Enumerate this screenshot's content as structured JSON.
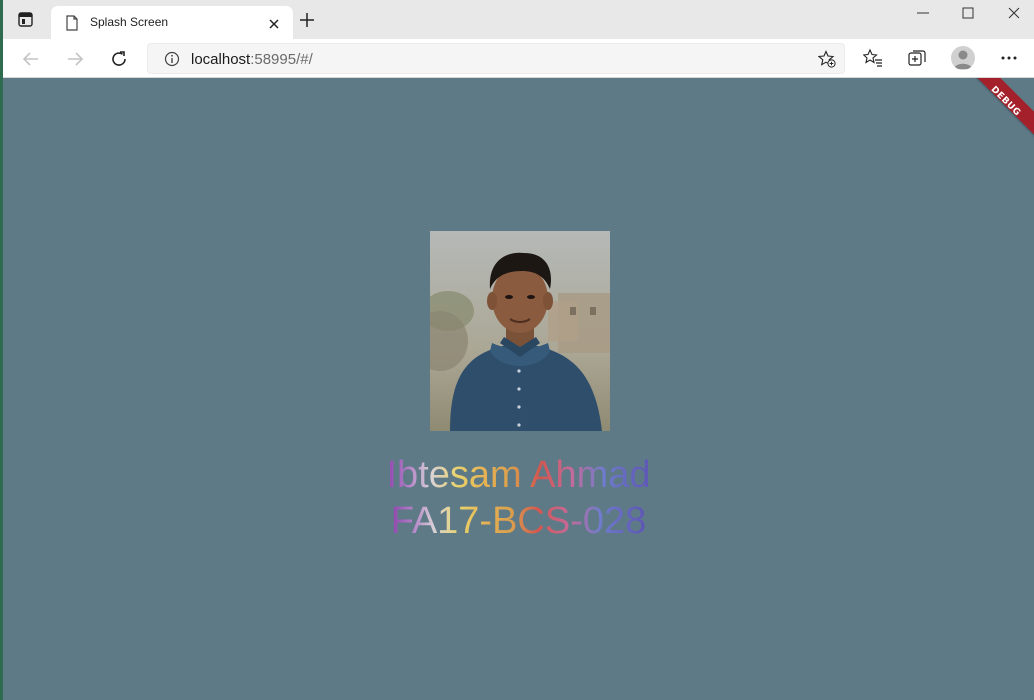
{
  "browser": {
    "tab_title": "Splash Screen",
    "url_host": "localhost",
    "url_rest": ":58995/#/"
  },
  "icons": {
    "tab_actions": "tab-actions-icon",
    "tab_document": "document-icon",
    "tab_close": "close-icon",
    "new_tab": "plus-icon",
    "minimize": "minimize-icon",
    "maximize": "maximize-icon",
    "window_close": "close-icon",
    "back": "arrow-left-icon",
    "forward": "arrow-right-icon",
    "refresh": "refresh-icon",
    "site_info": "info-icon",
    "add_favorite": "star-plus-icon",
    "favorites": "favorites-icon",
    "collections": "collections-icon",
    "profile": "profile-icon",
    "more": "more-icon"
  },
  "app": {
    "debug_banner": "DEBUG",
    "name": "Ibtesam Ahmad",
    "reg_no": "FA17-BCS-028",
    "background_color": "#5f7a87"
  }
}
